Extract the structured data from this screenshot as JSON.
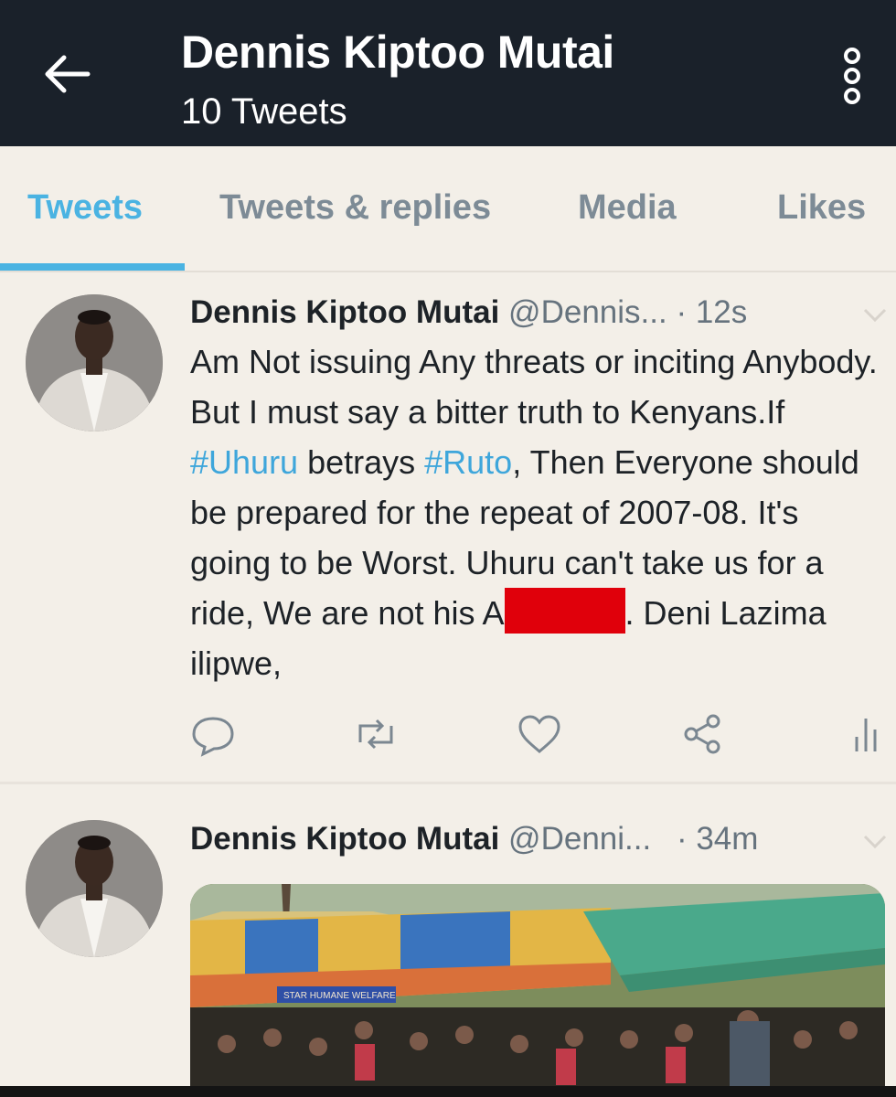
{
  "header": {
    "title": "Dennis Kiptoo Mutai",
    "subtitle": "10 Tweets",
    "back_icon": "arrow-left-icon",
    "more_icon": "vertical-ellipsis-icon"
  },
  "tabs": [
    {
      "label": "Tweets",
      "active": true
    },
    {
      "label": "Tweets & replies",
      "active": false
    },
    {
      "label": "Media",
      "active": false
    },
    {
      "label": "Likes",
      "active": false
    }
  ],
  "tweets": [
    {
      "name": "Dennis Kiptoo Mutai",
      "handle": "@Dennis...",
      "time": "· 12s",
      "text": {
        "p1": "Am Not issuing Any threats or inciting Anybody. But I must say a bitter truth to Kenyans.If ",
        "tag1": "#Uhuru",
        "p2": " betrays ",
        "tag2": "#Ruto",
        "p3": ", Then Everyone should be prepared for the repeat of 2007-08. It's going to be Worst. Uhuru can't take us for a ride, We are not his A",
        "p4": ". Deni Lazima ilipwe,"
      },
      "actions": [
        "reply-icon",
        "retweet-icon",
        "like-icon",
        "share-icon",
        "analytics-icon"
      ]
    },
    {
      "name": "Dennis Kiptoo Mutai",
      "handle": "@Denni...",
      "time": "· 34m",
      "media_banner": "STAR HUMANE WELFARE"
    }
  ],
  "colors": {
    "topbar": "#1a212a",
    "background": "#f3efe8",
    "accent": "#4ab3e2",
    "hashtag": "#3ea6db",
    "muted": "#66737e",
    "redaction": "#e0000b"
  }
}
